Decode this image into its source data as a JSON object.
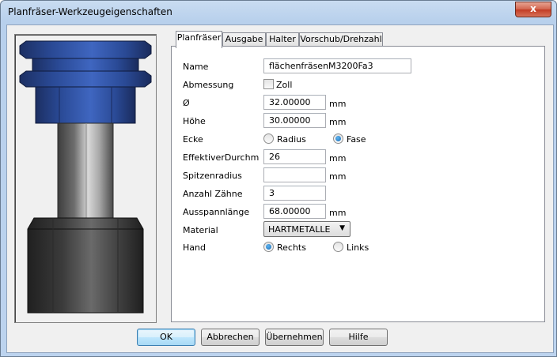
{
  "window": {
    "title": "Planfräser-Werkzeugeigenschaften",
    "close_glyph": "x"
  },
  "tabs": [
    {
      "label": "Planfräser",
      "active": true
    },
    {
      "label": "Ausgabe",
      "active": false
    },
    {
      "label": "Halter",
      "active": false
    },
    {
      "label": "Vorschub/Drehzahl",
      "active": false
    }
  ],
  "form": {
    "name_label": "Name",
    "name_value": "flächenfräsenM3200Fa3",
    "abmessung_label": "Abmessung",
    "zoll_label": "Zoll",
    "zoll_checked": false,
    "diameter_label": "Ø",
    "diameter_value": "32.00000",
    "diameter_unit": "mm",
    "hoehe_label": "Höhe",
    "hoehe_value": "30.00000",
    "hoehe_unit": "mm",
    "ecke_label": "Ecke",
    "radius_label": "Radius",
    "fase_label": "Fase",
    "ecke_selected": "Fase",
    "effektiv_label": "EffektiverDurchm",
    "effektiv_value": "26",
    "effektiv_unit": "mm",
    "spitzen_label": "Spitzenradius",
    "spitzen_value": "",
    "spitzen_unit": "mm",
    "zaehne_label": "Anzahl Zähne",
    "zaehne_value": "3",
    "ausspann_label": "Ausspannlänge",
    "ausspann_value": "68.00000",
    "ausspann_unit": "mm",
    "material_label": "Material",
    "material_value": "HARTMETALLE",
    "hand_label": "Hand",
    "rechts_label": "Rechts",
    "links_label": "Links",
    "hand_selected": "Rechts"
  },
  "buttons": {
    "ok": "OK",
    "abbrechen": "Abbrechen",
    "uebernehmen": "Übernehmen",
    "hilfe": "Hilfe"
  },
  "colors": {
    "holder_blue": "#2c4f9c",
    "shank_grey": "#9b9b9b",
    "cutter_dark": "#3a3a3a"
  }
}
